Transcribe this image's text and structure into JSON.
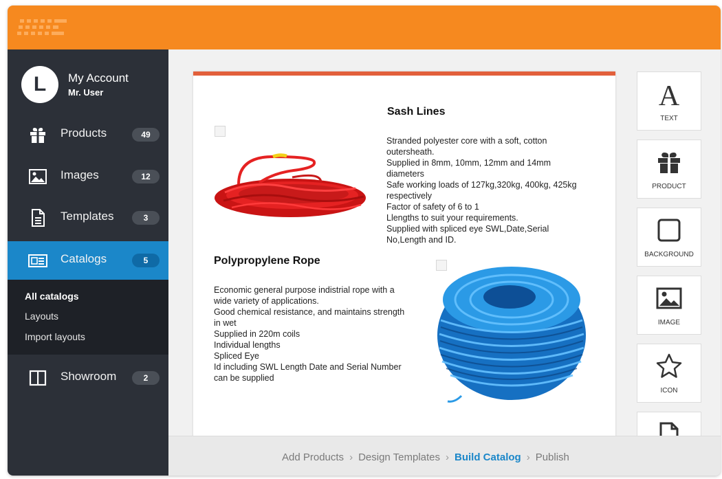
{
  "colors": {
    "topbar": "#f6891f",
    "sidebar": "#2c3038",
    "active": "#1b87c9",
    "accent_line": "#e2603b"
  },
  "account": {
    "initial": "L",
    "label": "My Account",
    "user": "Mr. User"
  },
  "nav": {
    "items": [
      {
        "label": "Products",
        "count": "49",
        "icon": "gift-icon"
      },
      {
        "label": "Images",
        "count": "12",
        "icon": "image-icon"
      },
      {
        "label": "Templates",
        "count": "3",
        "icon": "document-icon"
      },
      {
        "label": "Catalogs",
        "count": "5",
        "icon": "catalog-icon"
      },
      {
        "label": "Showroom",
        "count": "2",
        "icon": "showroom-icon"
      }
    ],
    "submenu": [
      "All catalogs",
      "Layouts",
      "Import layouts"
    ]
  },
  "products": [
    {
      "title": "Sash Lines",
      "lines": [
        "Stranded polyester core with a soft, cotton",
        "outersheath.",
        "Supplied in 8mm, 10mm, 12mm and 14mm",
        "diameters",
        "Safe working loads of 127kg,320kg, 400kg, 425kg",
        "respectively",
        "Factor of safety of 6 to 1",
        "Llengths to suit your requirements.",
        "Supplied with spliced eye SWL,Date,Serial",
        "No,Length and ID."
      ],
      "image": "red-rope-image"
    },
    {
      "title": "Polypropylene Rope",
      "lines": [
        "Economic general purpose indistrial rope with a",
        "wide variety of applications.",
        "Good chemical resistance, and maintains strength",
        "in wet",
        "Supplied in 220m coils",
        "Individual lengths",
        "Spliced Eye",
        "Id including SWL Length Date and Serial Number",
        "can be supplied"
      ],
      "image": "blue-rope-image"
    }
  ],
  "tools": [
    {
      "label": "TEXT",
      "icon": "text-icon"
    },
    {
      "label": "PRODUCT",
      "icon": "gift-icon"
    },
    {
      "label": "BACKGROUND",
      "icon": "square-icon"
    },
    {
      "label": "IMAGE",
      "icon": "image-icon"
    },
    {
      "label": "ICON",
      "icon": "star-icon"
    }
  ],
  "breadcrumb": [
    "Add Products",
    "Design Templates",
    "Build Catalog",
    "Publish"
  ]
}
